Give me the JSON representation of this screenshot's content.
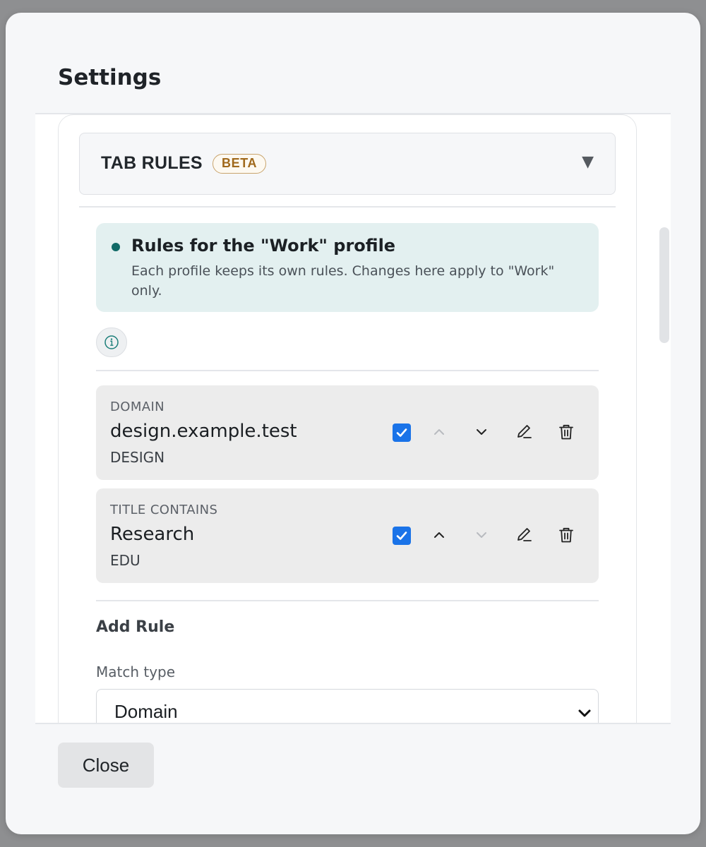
{
  "dialog": {
    "title": "Settings",
    "close_label": "Close"
  },
  "section": {
    "title": "TAB RULES",
    "badge": "BETA",
    "toggle_icon": "triangle-down-icon"
  },
  "notice": {
    "title": "Rules for the \"Work\" profile",
    "body": "Each profile keeps its own rules. Changes here apply to \"Work\" only.",
    "accent_color": "#116a67"
  },
  "rules": [
    {
      "type": "DOMAIN",
      "value": "design.example.test",
      "group": "DESIGN",
      "enabled": true,
      "can_move_up": false,
      "can_move_down": true
    },
    {
      "type": "TITLE CONTAINS",
      "value": "Research",
      "group": "EDU",
      "enabled": true,
      "can_move_up": true,
      "can_move_down": false
    }
  ],
  "add_rule": {
    "title": "Add Rule",
    "match_type_label": "Match type",
    "match_type_value": "Domain"
  },
  "colors": {
    "checkbox": "#1a73e8",
    "badge": "#a0691c"
  }
}
